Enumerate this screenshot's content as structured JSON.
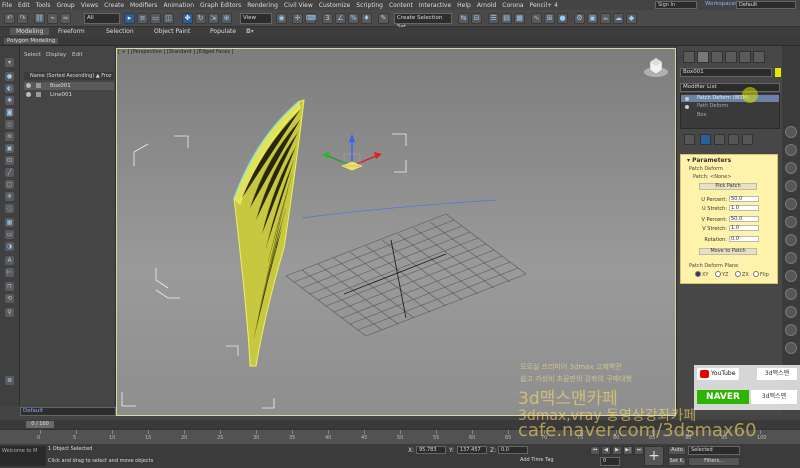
{
  "menu": {
    "items": [
      "File",
      "Edit",
      "Tools",
      "Group",
      "Views",
      "Create",
      "Modifiers",
      "Animation",
      "Graph Editors",
      "Rendering",
      "Civil View",
      "Customize",
      "Scripting",
      "Content",
      "Interactive",
      "Help",
      "Arnold",
      "Corona",
      "Pencil+ 4"
    ],
    "signin": "Sign In",
    "workspaces_label": "Workspaces:",
    "workspace": "Default"
  },
  "toolbar": {
    "filter_all": "All",
    "view": "View",
    "selection_set": "Create Selection Set"
  },
  "ribbon": {
    "tabs": [
      "Modeling",
      "Freeform",
      "Selection",
      "Object Paint",
      "Populate"
    ],
    "active_tab": "Modeling",
    "sub": "Polygon Modeling"
  },
  "explorer": {
    "tabs": [
      "Select",
      "Display",
      "Edit"
    ],
    "header": "Name (Sorted Ascending)",
    "header_suffix": "▲ Froz",
    "objects": [
      {
        "name": "Box001",
        "selected": true
      },
      {
        "name": "Line001",
        "selected": false
      }
    ],
    "layer": "Default"
  },
  "viewport": {
    "label": "[ + ] [Perspective ] [Standard ] [Edged Faces ]"
  },
  "command_panel": {
    "object_name": "Box001",
    "object_color": "#e6e600",
    "modifier_list": "Modifier List",
    "stack": [
      {
        "name": "Patch Deform (WSM)",
        "selected": true
      },
      {
        "name": "Path Deform",
        "selected": false
      },
      {
        "name": "Box",
        "selected": false
      }
    ],
    "params": {
      "title": "Parameters",
      "group_patch_deform": "Patch Deform",
      "patch_label": "Patch: <None>",
      "pick_patch": "Pick Patch",
      "fields": [
        {
          "label": "U Percent:",
          "value": "50.0"
        },
        {
          "label": "U Stretch:",
          "value": "1.0"
        },
        {
          "label": "V Percent:",
          "value": "50.0"
        },
        {
          "label": "V Stretch:",
          "value": "1.0"
        },
        {
          "label": "Rotation:",
          "value": "0.0"
        }
      ],
      "move_to_patch": "Move to Patch",
      "plane_group": "Patch Deform Plane",
      "planes": [
        {
          "label": "XY",
          "on": true
        },
        {
          "label": "YZ",
          "on": false
        },
        {
          "label": "ZX",
          "on": false
        },
        {
          "label": "Flip",
          "on": false
        }
      ]
    }
  },
  "timeline": {
    "current": "0 / 100",
    "ticks": [
      "0",
      "5",
      "10",
      "15",
      "20",
      "25",
      "30",
      "35",
      "40",
      "45",
      "50",
      "55",
      "60",
      "65",
      "70",
      "75",
      "80",
      "85",
      "90",
      "95",
      "100"
    ]
  },
  "status": {
    "maxscript": "Welcome to M",
    "line1": "1 Object Selected",
    "line2": "Click and drag to select and move objects",
    "x": "95.783",
    "y": "137.457",
    "z": "0.0",
    "add_time_tag": "Add Time Tag",
    "frame": "0",
    "auto": "Auto",
    "set_k": "Set K.",
    "selected": "Selected",
    "filters": "Filters..."
  },
  "watermark": {
    "line1": "모르실 프리미어 3dmax 고재백관",
    "line2": "쉽고 가성비 초끝판의 강좌의 구매대행",
    "line3": "3d맥스맨카페",
    "line4": "3dmax,vray 동영상강좌카페",
    "line5": "cafe.naver.com/3dsmax60",
    "youtube": "YouTube",
    "youtube_name": "3d맥스맨",
    "naver": "NAVER",
    "naver_name": "3d맥스맨"
  }
}
